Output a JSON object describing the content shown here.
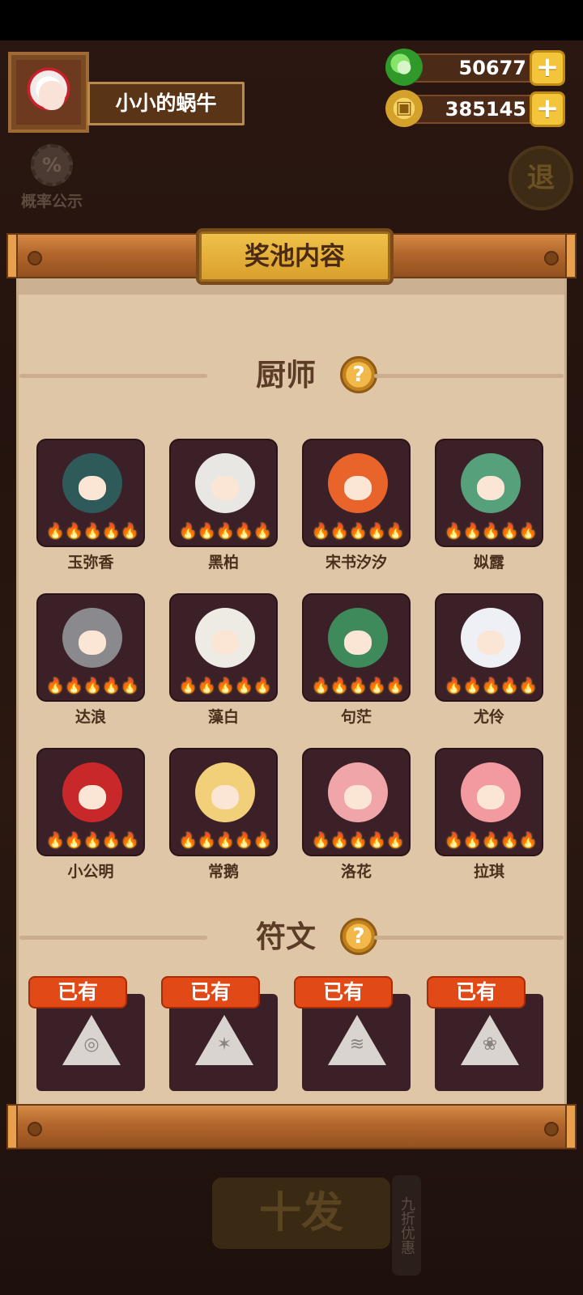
{
  "background": {
    "probability_label": "概率公示",
    "exit_label": "退",
    "bottom_button_label": "十发",
    "side_tag_label": "九折优惠"
  },
  "player": {
    "name": "小小的蜗牛"
  },
  "currencies": [
    {
      "icon": "jade-icon",
      "value": "50677"
    },
    {
      "icon": "coin-icon",
      "value": "385145"
    }
  ],
  "panel": {
    "title": "奖池内容",
    "chef_section_label": "厨师",
    "rune_section_label": "符文",
    "help_symbol": "?"
  },
  "chefs": [
    {
      "name": "玉弥香",
      "stars": 5,
      "color": "#2f5a5a"
    },
    {
      "name": "黑柏",
      "stars": 5,
      "color": "#e9e7e4"
    },
    {
      "name": "宋书汐汐",
      "stars": 5,
      "color": "#e8642a"
    },
    {
      "name": "姒露",
      "stars": 5,
      "color": "#56a07c"
    },
    {
      "name": "达浪",
      "stars": 5,
      "color": "#8a8a8e"
    },
    {
      "name": "藻白",
      "stars": 5,
      "color": "#eeeae4"
    },
    {
      "name": "句茫",
      "stars": 5,
      "color": "#3e8a5a"
    },
    {
      "name": "尤伶",
      "stars": 5,
      "color": "#eef0f6"
    },
    {
      "name": "小公明",
      "stars": 5,
      "color": "#c8282a"
    },
    {
      "name": "常鹅",
      "stars": 5,
      "color": "#f2d07a"
    },
    {
      "name": "洛花",
      "stars": 5,
      "color": "#f0a6a8"
    },
    {
      "name": "拉琪",
      "stars": 5,
      "color": "#f29aa0"
    }
  ],
  "runes": [
    {
      "badge": "已有",
      "icon": "spiral-rune-icon",
      "glyph": "◎"
    },
    {
      "badge": "已有",
      "icon": "crab-rune-icon",
      "glyph": "✶"
    },
    {
      "badge": "已有",
      "icon": "cake-rune-icon",
      "glyph": "≋"
    },
    {
      "badge": "已有",
      "icon": "flower-rune-icon",
      "glyph": "❀"
    }
  ],
  "colors": {
    "accent_gold": "#f3c53a",
    "badge_red": "#e14a16",
    "card_bg": "#3b2027",
    "paper": "#dfc6a7"
  }
}
